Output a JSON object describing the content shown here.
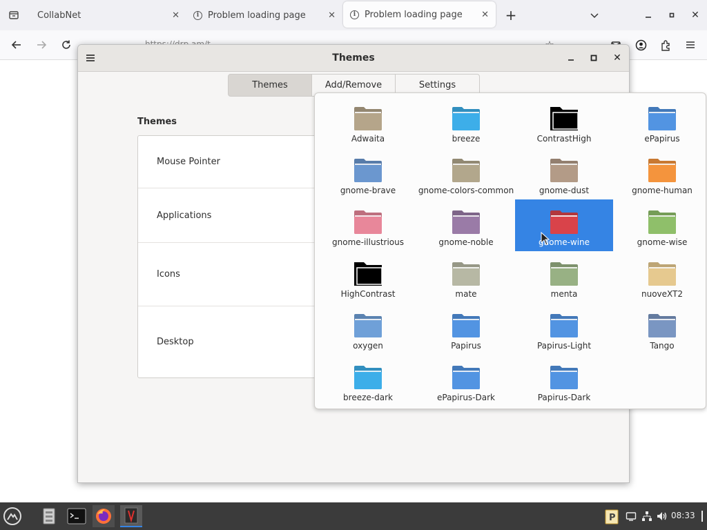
{
  "browser": {
    "tabs": [
      {
        "title": "CollabNet"
      },
      {
        "title": "Problem loading page"
      },
      {
        "title": "Problem loading page"
      }
    ],
    "new_tab_symbol": "+",
    "url": "https://drp.am/t"
  },
  "dialog": {
    "title": "Themes",
    "tabs": [
      "Themes",
      "Add/Remove",
      "Settings"
    ],
    "active_tab": "Themes",
    "section_heading": "Themes",
    "categories": [
      "Mouse Pointer",
      "Applications",
      "Icons",
      "Desktop"
    ]
  },
  "popover": {
    "selected": "gnome-wine",
    "themes": [
      {
        "name": "Adwaita",
        "icon": "folder-icon",
        "color": "#b5a58a"
      },
      {
        "name": "breeze",
        "icon": "folder-icon",
        "color": "#3daee9"
      },
      {
        "name": "ContrastHigh",
        "icon": "folder-icon",
        "color": "#000000"
      },
      {
        "name": "ePapirus",
        "icon": "folder-icon",
        "color": "#5294e2"
      },
      {
        "name": "gnome-brave",
        "icon": "folder-icon",
        "color": "#6b97cf"
      },
      {
        "name": "gnome-colors-common",
        "icon": "folder-icon",
        "color": "#b2a78c"
      },
      {
        "name": "gnome-dust",
        "icon": "folder-icon",
        "color": "#b39b87"
      },
      {
        "name": "gnome-human",
        "icon": "folder-icon",
        "color": "#f4943d"
      },
      {
        "name": "gnome-illustrious",
        "icon": "folder-icon",
        "color": "#e8879a"
      },
      {
        "name": "gnome-noble",
        "icon": "folder-icon",
        "color": "#9a7ba7"
      },
      {
        "name": "gnome-wine",
        "icon": "folder-icon",
        "color": "#d9434a"
      },
      {
        "name": "gnome-wise",
        "icon": "folder-icon",
        "color": "#8fbf6a"
      },
      {
        "name": "HighContrast",
        "icon": "folder-icon",
        "color": "#000000"
      },
      {
        "name": "mate",
        "icon": "folder-icon",
        "color": "#b7b8a4"
      },
      {
        "name": "menta",
        "icon": "folder-icon",
        "color": "#98b184"
      },
      {
        "name": "nuoveXT2",
        "icon": "folder-icon",
        "color": "#e6c98f"
      },
      {
        "name": "oxygen",
        "icon": "folder-icon",
        "color": "#6fa0d8"
      },
      {
        "name": "Papirus",
        "icon": "folder-icon",
        "color": "#5294e2"
      },
      {
        "name": "Papirus-Light",
        "icon": "folder-icon",
        "color": "#5294e2"
      },
      {
        "name": "Tango",
        "icon": "folder-icon",
        "color": "#7a96c2"
      },
      {
        "name": "breeze-dark",
        "icon": "folder-icon",
        "color": "#3daee9"
      },
      {
        "name": "ePapirus-Dark",
        "icon": "folder-icon",
        "color": "#5294e2"
      },
      {
        "name": "Papirus-Dark",
        "icon": "folder-icon",
        "color": "#5294e2"
      }
    ]
  },
  "taskbar": {
    "clock": "08:33",
    "apps": [
      "start-menu-icon",
      "file-manager-icon",
      "terminal-icon",
      "firefox-icon",
      "text-editor-icon"
    ]
  },
  "colors": {
    "accent": "#3584e4",
    "taskbar": "#3b3b3b"
  }
}
